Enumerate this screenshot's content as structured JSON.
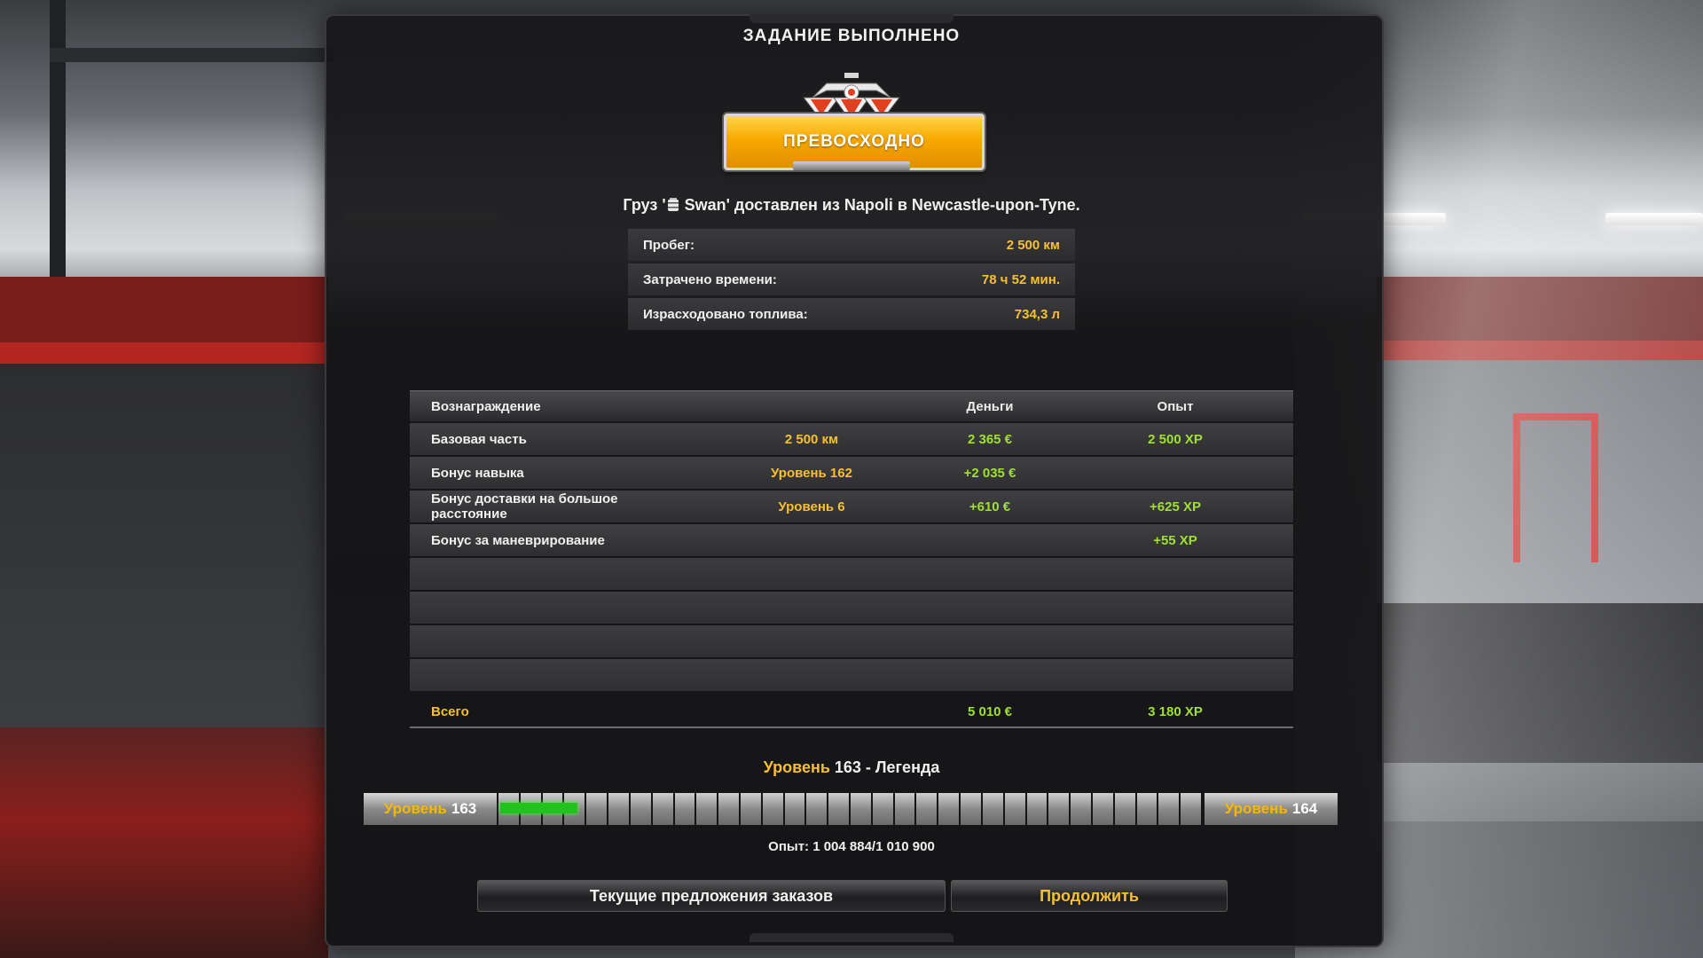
{
  "header": {
    "title": "ЗАДАНИЕ ВЫПОЛНЕНО"
  },
  "badge": {
    "label": "ПРЕВОСХОДНО"
  },
  "delivery": {
    "prefix": "Груз '",
    "suffix": " Swan' доставлен из Napoli в Newcastle-upon-Tyne."
  },
  "stats": [
    {
      "label": "Пробег:",
      "value": "2 500 км"
    },
    {
      "label": "Затрачено времени:",
      "value": "78 ч 52 мин."
    },
    {
      "label": "Израсходовано топлива:",
      "value": "734,3 л"
    }
  ],
  "rewards": {
    "headers": {
      "name": "Вознаграждение",
      "money": "Деньги",
      "xp": "Опыт"
    },
    "rows": [
      {
        "name": "Базовая часть",
        "mid": "2 500 км",
        "money": "2 365 €",
        "xp": "2 500 XP"
      },
      {
        "name": "Бонус навыка",
        "mid": "Уровень 162",
        "money": "+2 035 €",
        "xp": ""
      },
      {
        "name": "Бонус доставки на большое расстояние",
        "mid": "Уровень 6",
        "money": "+610 €",
        "xp": "+625 XP"
      },
      {
        "name": "Бонус за маневрирование",
        "mid": "",
        "money": "",
        "xp": "+55 XP"
      }
    ],
    "total": {
      "name": "Всего",
      "money": "5 010 €",
      "xp": "3 180 XP"
    }
  },
  "level": {
    "title_prefix": "Уровень",
    "title_rest": " 163 - Легенда",
    "current_word": "Уровень",
    "current_num": "163",
    "next_word": "Уровень",
    "next_num": "164",
    "progress_fraction": 0.11
  },
  "xp": {
    "text": "Опыт: 1 004 884/1 010 900"
  },
  "buttons": {
    "offers": "Текущие предложения заказов",
    "continue": "Продолжить"
  },
  "colors": {
    "accent": "#f8c030",
    "positive": "#9fe030",
    "progress": "#22c31e"
  }
}
